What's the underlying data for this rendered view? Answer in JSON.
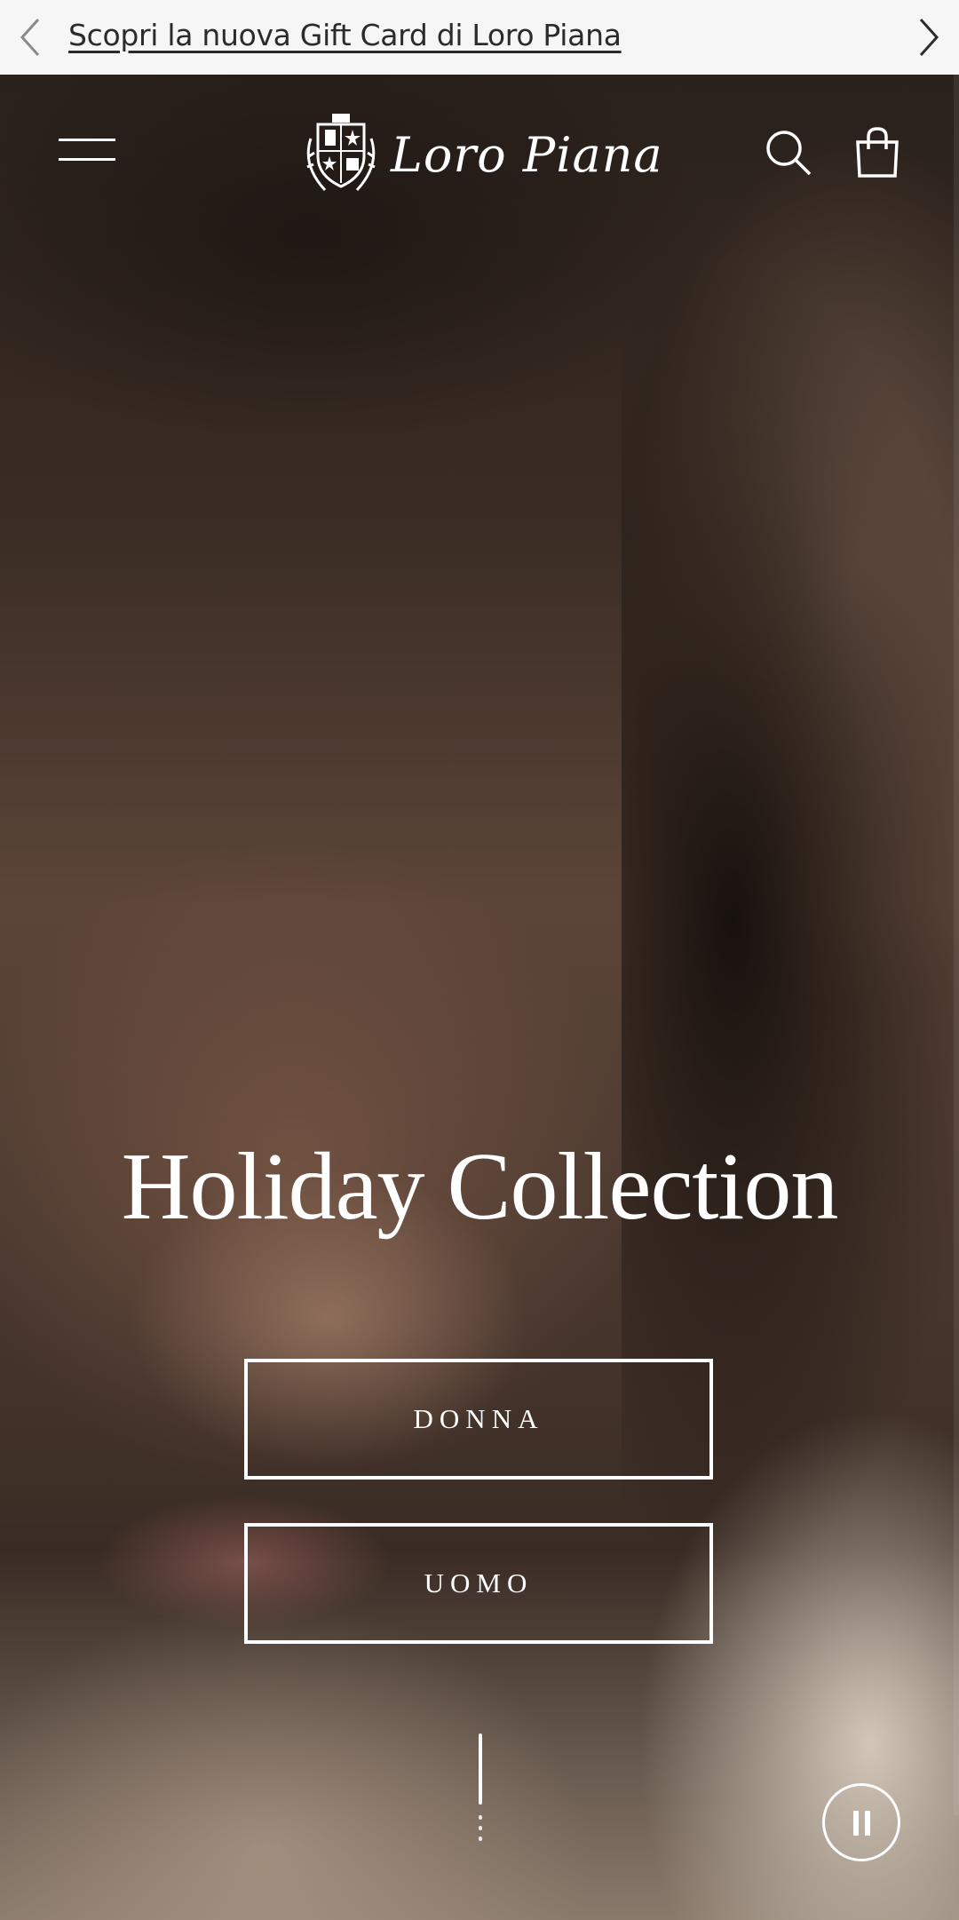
{
  "announcement": {
    "text": "Scopri la nuova Gift Card di Loro Piana",
    "prev_icon": "chevron-left-icon",
    "next_icon": "chevron-right-icon"
  },
  "header": {
    "menu_icon": "hamburger-menu-icon",
    "logo_text": "Loro Piana",
    "search_icon": "search-icon",
    "cart_icon": "shopping-bag-icon"
  },
  "hero": {
    "title": "Holiday Collection",
    "buttons": [
      {
        "label": "DONNA"
      },
      {
        "label": "UOMO"
      }
    ],
    "pause_icon": "pause-icon",
    "scroll_icon": "scroll-indicator-icon"
  },
  "colors": {
    "announcement_bg": "#f6f6f6",
    "announcement_text": "#2b2b2b",
    "overlay_text": "#ffffff"
  }
}
